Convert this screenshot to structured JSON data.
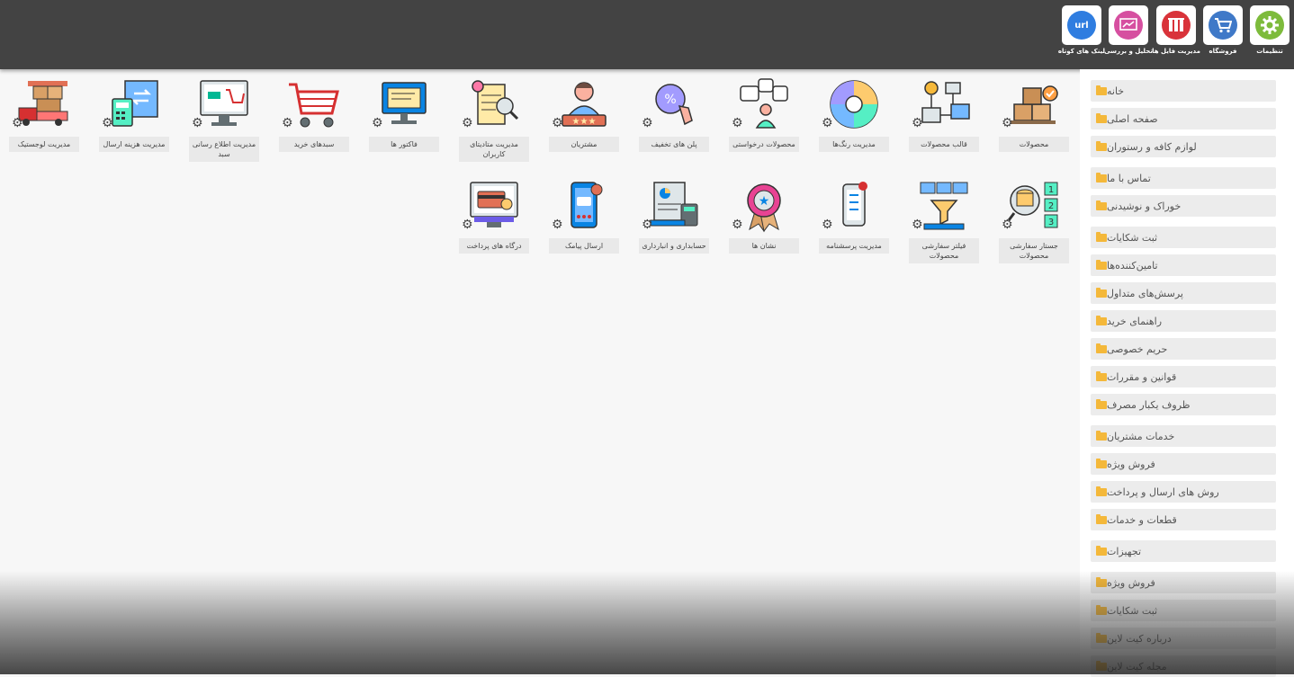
{
  "topbar": {
    "tiles": [
      {
        "label": "تنظیمات",
        "icon": "settings-icon",
        "color": "#7dbb3c"
      },
      {
        "label": "فروشگاه",
        "icon": "cart-icon",
        "color": "#3f79c8"
      },
      {
        "label": "مدیریت فایل ها",
        "icon": "files-icon",
        "color": "#d9333a"
      },
      {
        "label": "تحلیل و بررسی",
        "icon": "analytics-icon",
        "color": "#d64fa0"
      },
      {
        "label": "لینک های کوتاه",
        "icon": "url-icon",
        "color": "#2f7de0",
        "text": "url"
      }
    ]
  },
  "sidebar": {
    "items": [
      {
        "label": "خانه"
      },
      {
        "label": "صفحه اصلی"
      },
      {
        "label": "لوازم کافه و رستوران"
      },
      {
        "label": "تماس با ما"
      },
      {
        "label": "خوراک و نوشیدنی"
      },
      {
        "label": "ثبت شکایات"
      },
      {
        "label": "تامین‌کننده‌ها"
      },
      {
        "label": "پرسش‌های متداول"
      },
      {
        "label": "راهنمای خرید"
      },
      {
        "label": "حریم خصوصی"
      },
      {
        "label": "قوانین و مقررات"
      },
      {
        "label": "ظروف یکبار مصرف"
      },
      {
        "label": "خدمات مشتریان"
      },
      {
        "label": "فروش ویژه"
      },
      {
        "label": "روش های ارسال و پرداخت"
      },
      {
        "label": "قطعات و خدمات"
      },
      {
        "label": "تجهیزات"
      },
      {
        "label": "فروش ویژه"
      },
      {
        "label": "ثبت شکایات"
      },
      {
        "label": "درباره کیت لاین"
      },
      {
        "label": "مجله کیت لاین"
      }
    ]
  },
  "grid": {
    "row1": [
      {
        "label": "محصولات",
        "icon": "boxes-icon"
      },
      {
        "label": "قالب محصولات",
        "icon": "product-template-icon"
      },
      {
        "label": "مدیریت رنگ‌ها",
        "icon": "color-wheel-icon"
      },
      {
        "label": "محصولات درخواستی",
        "icon": "requested-products-icon"
      },
      {
        "label": "پلن های تخفیف",
        "icon": "discount-icon"
      },
      {
        "label": "مشتریان",
        "icon": "customer-icon"
      },
      {
        "label": "مدیریت متادیتای کاربران",
        "icon": "user-metadata-icon"
      },
      {
        "label": "فاکتور ها",
        "icon": "invoice-icon"
      },
      {
        "label": "سبدهای خرید",
        "icon": "shopping-cart-icon"
      },
      {
        "label": "مدیریت اطلاع رسانی سبد",
        "icon": "cart-notify-icon"
      },
      {
        "label": "مدیریت هزینه ارسال",
        "icon": "shipping-cost-icon"
      },
      {
        "label": "مدیریت لوجستیک",
        "icon": "logistics-icon"
      }
    ],
    "row2": [
      {
        "label": "جستار سفارشی محصولات",
        "icon": "custom-query-icon"
      },
      {
        "label": "فیلتر سفارشی محصولات",
        "icon": "custom-filter-icon"
      },
      {
        "label": "مدیریت پرسشنامه",
        "icon": "questionnaire-icon"
      },
      {
        "label": "نشان ها",
        "icon": "badge-icon"
      },
      {
        "label": "حسابداری و انبارداری",
        "icon": "accounting-icon"
      },
      {
        "label": "ارسال پیامک",
        "icon": "sms-icon"
      },
      {
        "label": "درگاه های پرداخت",
        "icon": "payment-gateway-icon"
      }
    ]
  }
}
